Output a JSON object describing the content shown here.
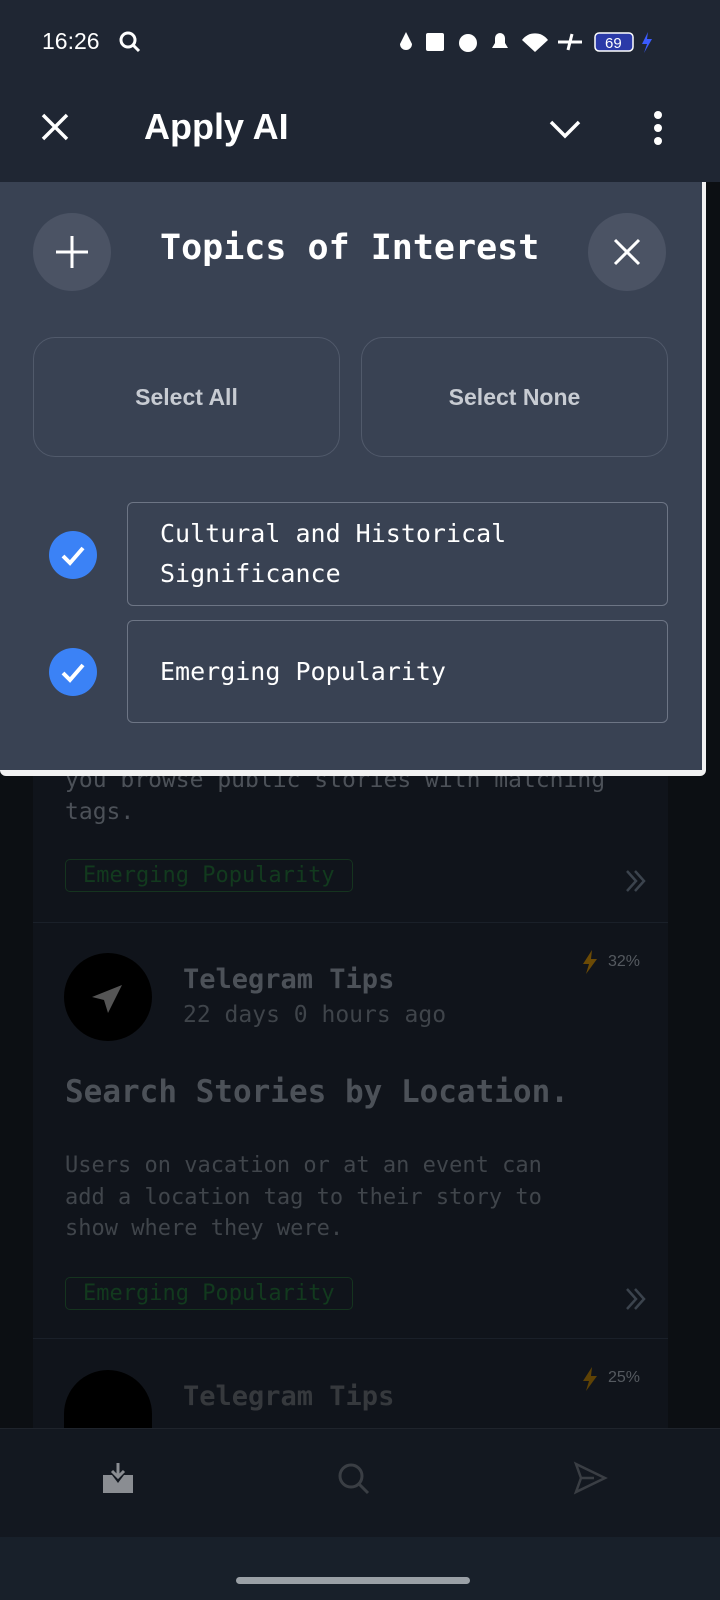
{
  "status_bar": {
    "time": "16:26",
    "battery": "69"
  },
  "header": {
    "title": "Apply AI"
  },
  "panel": {
    "title": "Topics of Interest",
    "select_all": "Select All",
    "select_none": "Select None",
    "topics": [
      {
        "label": "Cultural and Historical Significance",
        "checked": true
      },
      {
        "label": "Emerging Popularity",
        "checked": true
      }
    ]
  },
  "feed": {
    "card1": {
      "body_tail": [
        "you browse public stories with matching",
        "tags."
      ],
      "tag": "Emerging Popularity"
    },
    "card2": {
      "channel": "Telegram Tips",
      "time": "22 days 0 hours ago",
      "badge": "32%",
      "headline": "Search Stories by Location.",
      "body": [
        "Users on vacation or at an event can",
        "add a location tag to their story to",
        "show where they were."
      ],
      "tag": "Emerging Popularity"
    },
    "card3": {
      "channel": "Telegram Tips",
      "badge": "25%"
    }
  },
  "colors": {
    "accent": "#3b82f6",
    "panel": "#394253",
    "header": "#1f2633"
  }
}
